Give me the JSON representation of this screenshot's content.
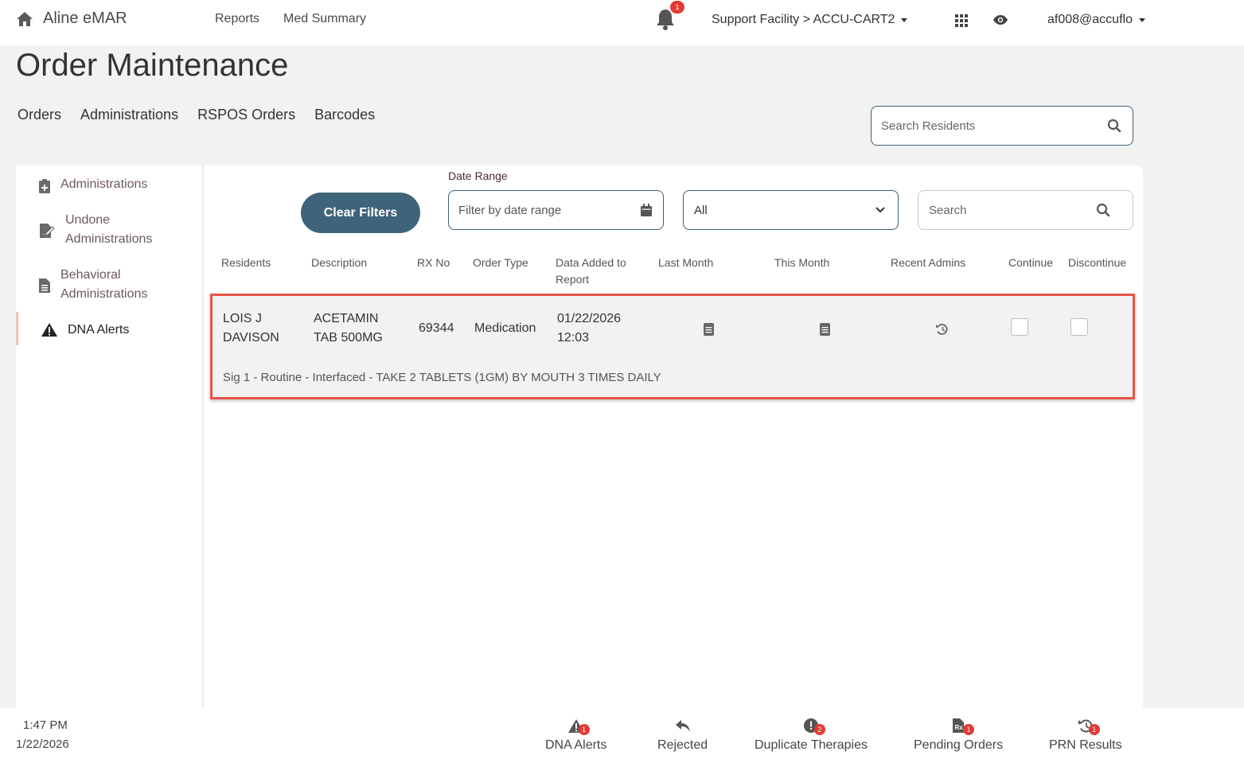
{
  "app": {
    "brand": "Aline eMAR",
    "nav": [
      "Reports",
      "Med Summary"
    ],
    "notification_count": "1",
    "facility": "Support Facility > ACCU-CART2",
    "user": "af008@accuflo"
  },
  "page": {
    "title": "Order Maintenance",
    "tabs": [
      "Orders",
      "Administrations",
      "RSPOS Orders",
      "Barcodes"
    ],
    "search_residents_placeholder": "Search Residents"
  },
  "sidebar": {
    "items": [
      {
        "label": "Administrations",
        "icon": "clipboard-plus-icon"
      },
      {
        "label": "Undone Administrations",
        "icon": "signature-icon"
      },
      {
        "label": "Behavioral Administrations",
        "icon": "document-icon"
      },
      {
        "label": "DNA Alerts",
        "icon": "warning-icon",
        "active": true
      }
    ]
  },
  "filters": {
    "clear_label": "Clear Filters",
    "date_range_label": "Date Range",
    "date_placeholder": "Filter by date range",
    "select_value": "All",
    "search_placeholder": "Search"
  },
  "table": {
    "headers": [
      "Residents",
      "Description",
      "RX No",
      "Order Type",
      "Data Added to Report",
      "Last Month",
      "This Month",
      "Recent Admins",
      "Continue",
      "Discontinue"
    ],
    "rows": [
      {
        "resident": "LOIS J DAVISON",
        "description": "ACETAMIN TAB 500MG",
        "rx_no": "69344",
        "order_type": "Medication",
        "date_added": "01/22/2026 12:03",
        "continue": false,
        "discontinue": false,
        "sig": "Sig 1 - Routine - Interfaced - TAKE 2 TABLETS (1GM) BY MOUTH 3 TIMES DAILY"
      }
    ]
  },
  "footer": {
    "time": "1:47 PM",
    "date": "1/22/2026",
    "items": [
      {
        "label": "DNA Alerts",
        "badge": "1",
        "icon": "warning-icon"
      },
      {
        "label": "Rejected",
        "badge": "",
        "icon": "reply-icon"
      },
      {
        "label": "Duplicate Therapies",
        "badge": "2",
        "icon": "exclamation-icon"
      },
      {
        "label": "Pending Orders",
        "badge": "1",
        "icon": "rx-file-icon"
      },
      {
        "label": "PRN Results",
        "badge": "1",
        "icon": "history-icon"
      }
    ]
  },
  "colors": {
    "accent": "#3f6479",
    "highlight_border": "#e5564a",
    "badge": "#e53935"
  }
}
